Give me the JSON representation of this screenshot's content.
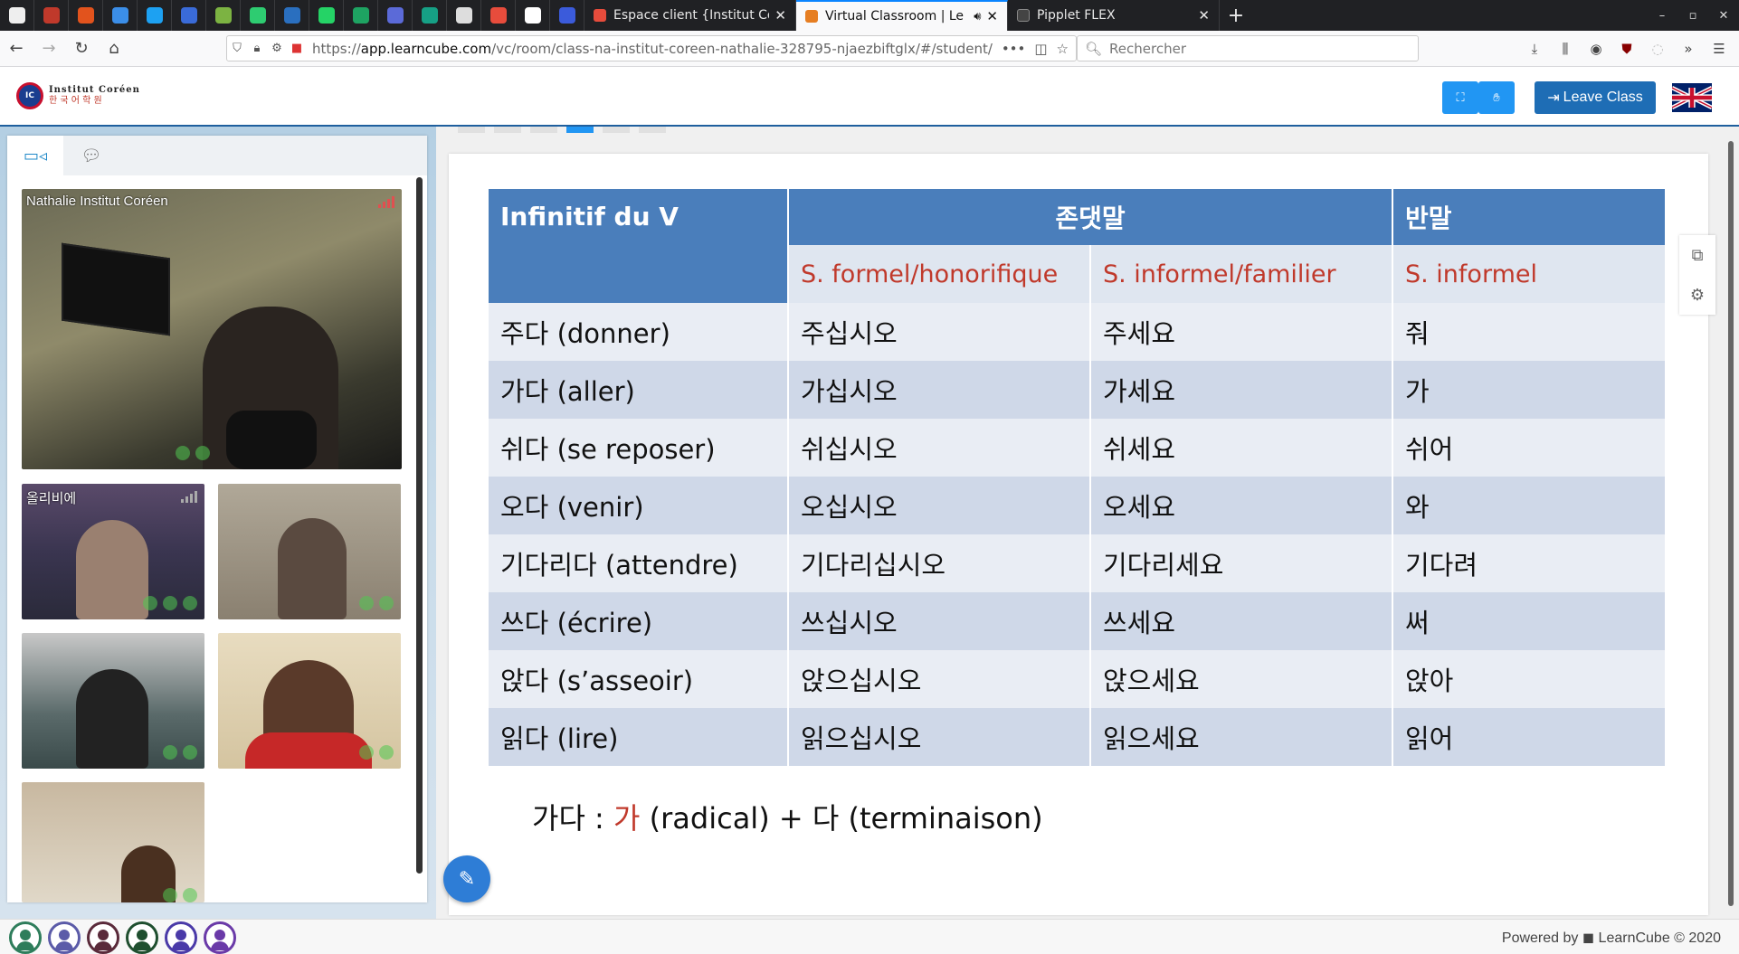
{
  "browser": {
    "tabs": [
      {
        "title": "Espace client {Institut Co",
        "active": false,
        "favicon_color": "#e74c3c"
      },
      {
        "title": "Virtual Classroom | Le",
        "active": true,
        "favicon_color": "#e67e22"
      },
      {
        "title": "Pipplet FLEX",
        "active": false,
        "favicon_color": "#333333"
      }
    ],
    "url_host": "app.learncube.com",
    "url_prefix": "https://",
    "url_path": "/vc/room/class-na-institut-coreen-nathalie-328795-njaezbiftglx/#/student/",
    "search_placeholder": "Rechercher",
    "new_tab": "+",
    "close_glyph": "✕"
  },
  "app": {
    "logo_line1": "Institut Coréen",
    "logo_line2": "한 국 어 학 원",
    "leave_label": "Leave Class",
    "accent": "#2196f3",
    "brand_blue": "#1e6db5"
  },
  "videos": {
    "main_name": "Nathalie Institut Coréen",
    "tile1_name": "올리비에"
  },
  "table": {
    "col1_header": "Infinitif du V",
    "group_header": "존댓말",
    "col4_header": "반말",
    "sub1": "S. formel/honorifique",
    "sub2": "S. informel/familier",
    "sub3": "S. informel",
    "rows": [
      [
        "주다 (donner)",
        "주십시오",
        "주세요",
        "줘"
      ],
      [
        "가다 (aller)",
        "가십시오",
        "가세요",
        "가"
      ],
      [
        "쉬다 (se reposer)",
        "쉬십시오",
        "쉬세요",
        "쉬어"
      ],
      [
        "오다 (venir)",
        "오십시오",
        "오세요",
        "와"
      ],
      [
        "기다리다 (attendre)",
        "기다리십시오",
        "기다리세요",
        "기다려"
      ],
      [
        "쓰다 (écrire)",
        "쓰십시오",
        "쓰세요",
        "써"
      ],
      [
        "앉다 (s’asseoir)",
        "앉으십시오",
        "앉으세요",
        "앉아"
      ],
      [
        "읽다 (lire)",
        "읽으십시오",
        "읽으세요",
        "읽어"
      ]
    ]
  },
  "formula": {
    "word": "가다 :",
    "radical": "가",
    "radical_label": "(radical) +",
    "ending": "다",
    "ending_label": "(terminaison)"
  },
  "footer": {
    "powered": "Powered by ◼ LearnCube © 2020",
    "avatar_colors": [
      "#2e7d5b",
      "#5b5ba8",
      "#5a2a3a",
      "#1f4f2f",
      "#4a3aa8",
      "#6a3aa8"
    ]
  }
}
